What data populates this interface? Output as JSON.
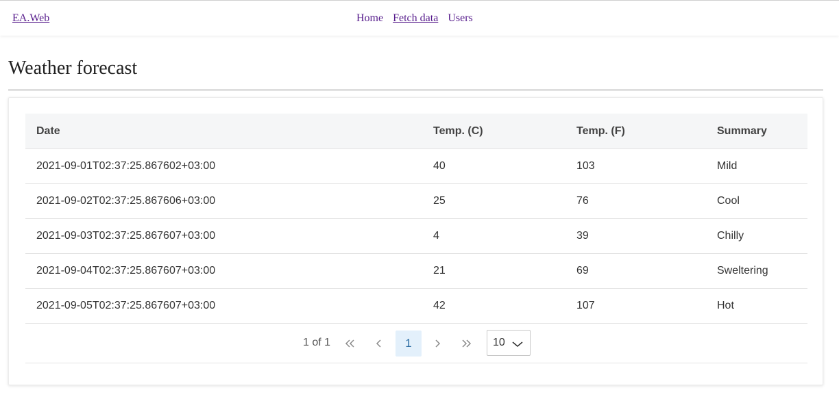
{
  "app": {
    "brand": "EA.Web"
  },
  "nav": {
    "items": [
      {
        "label": "Home"
      },
      {
        "label": "Fetch data"
      },
      {
        "label": "Users"
      }
    ]
  },
  "page": {
    "title": "Weather forecast"
  },
  "table": {
    "columns": [
      "Date",
      "Temp. (C)",
      "Temp. (F)",
      "Summary"
    ],
    "rows": [
      [
        "2021-09-01T02:37:25.867602+03:00",
        "40",
        "103",
        "Mild"
      ],
      [
        "2021-09-02T02:37:25.867606+03:00",
        "25",
        "76",
        "Cool"
      ],
      [
        "2021-09-03T02:37:25.867607+03:00",
        "4",
        "39",
        "Chilly"
      ],
      [
        "2021-09-04T02:37:25.867607+03:00",
        "21",
        "69",
        "Sweltering"
      ],
      [
        "2021-09-05T02:37:25.867607+03:00",
        "42",
        "107",
        "Hot"
      ]
    ]
  },
  "pager": {
    "info": "1 of 1",
    "current_page": "1",
    "page_size": "10",
    "icons": {
      "first": "double-chevron-left-icon",
      "prev": "chevron-left-icon",
      "next": "chevron-right-icon",
      "last": "double-chevron-right-icon",
      "dropdown": "chevron-down-icon"
    }
  },
  "colors": {
    "link": "#551a8b",
    "active_page_bg": "#e3f0fb",
    "header_bg": "#f5f6f7"
  }
}
